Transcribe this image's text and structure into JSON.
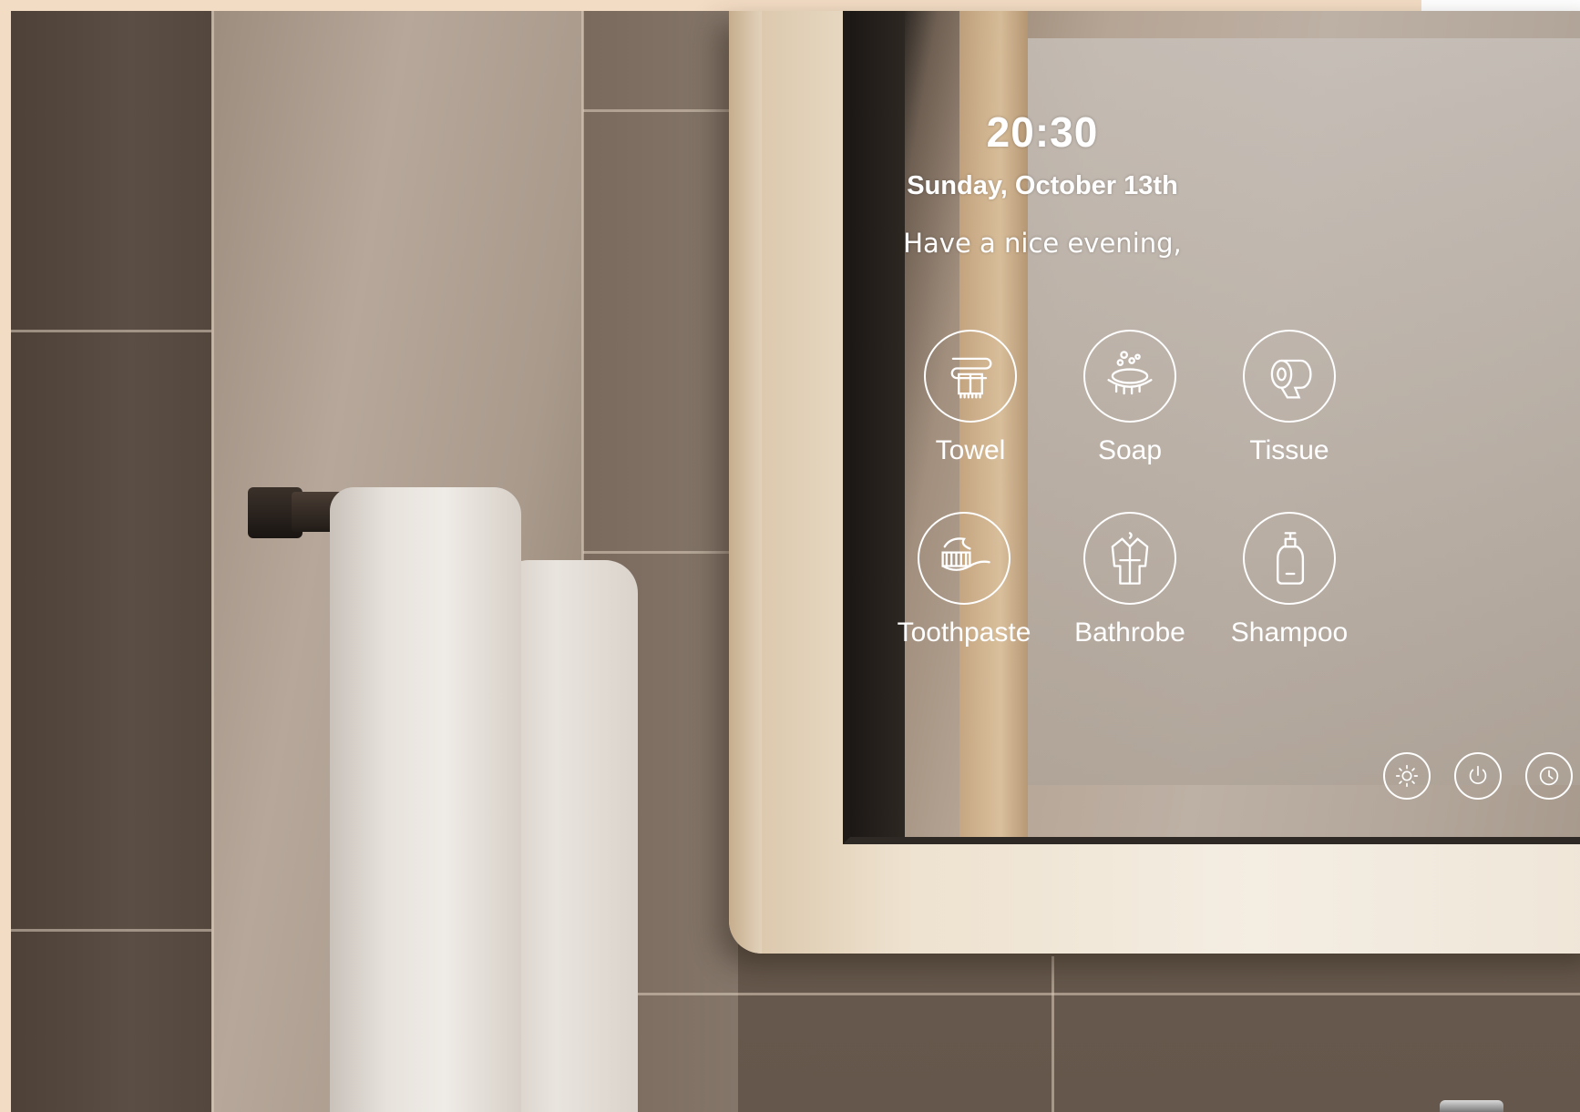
{
  "mirror": {
    "time": "20:30",
    "date": "Sunday, October 13th",
    "greeting": "Have a nice evening,"
  },
  "services": [
    {
      "label": "Towel",
      "icon": "towel-rack-icon"
    },
    {
      "label": "Soap",
      "icon": "soap-icon"
    },
    {
      "label": "Tissue",
      "icon": "tissue-roll-icon"
    },
    {
      "label": "Toothpaste",
      "icon": "toothpaste-icon"
    },
    {
      "label": "Bathrobe",
      "icon": "bathrobe-icon"
    },
    {
      "label": "Shampoo",
      "icon": "shampoo-bottle-icon"
    }
  ],
  "controls": [
    {
      "icon": "brightness-icon"
    },
    {
      "icon": "power-icon"
    },
    {
      "icon": "clock-icon"
    }
  ],
  "colors": {
    "ui_text": "#ffffff",
    "background_accent": "#f3dcc4"
  }
}
